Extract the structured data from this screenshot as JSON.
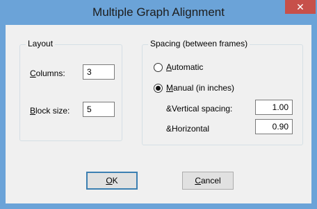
{
  "dialog": {
    "title": "Multiple Graph Alignment",
    "close_glyph": "✕"
  },
  "layout_group": {
    "legend": "Layout",
    "columns_label_mnemonic": "C",
    "columns_label_rest": "olumns:",
    "columns_value": "3",
    "block_size_label_mnemonic": "B",
    "block_size_label_rest": "lock size:",
    "block_size_value": "5"
  },
  "spacing_group": {
    "legend": "Spacing (between frames)",
    "automatic_mnemonic": "A",
    "automatic_rest": "utomatic",
    "automatic_selected": false,
    "manual_mnemonic": "M",
    "manual_rest": "anual (in inches)",
    "manual_selected": true,
    "vertical_label": "&Vertical spacing:",
    "vertical_value": "1.00",
    "horizontal_label": "&Horizontal",
    "horizontal_value": "0.90"
  },
  "buttons": {
    "ok_mnemonic": "O",
    "ok_rest": "K",
    "cancel_mnemonic": "C",
    "cancel_rest": "ancel"
  },
  "colors": {
    "title_bar": "#6ba3d8",
    "close_button": "#c7504a",
    "client_bg": "#f0f0f0"
  }
}
